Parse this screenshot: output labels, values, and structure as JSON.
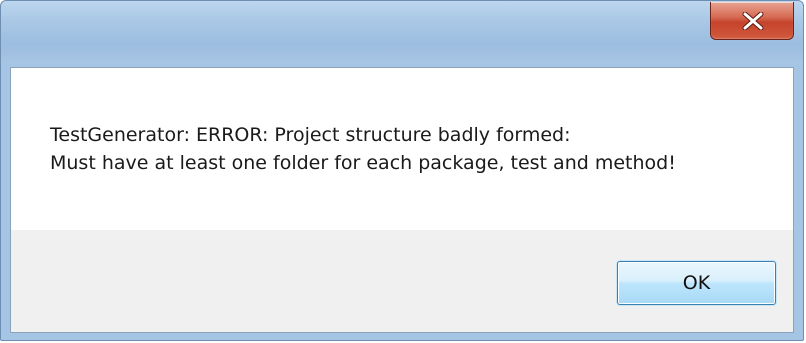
{
  "window": {
    "title": "",
    "close_icon": "close-icon"
  },
  "message": {
    "line1": "TestGenerator: ERROR: Project structure badly formed:",
    "line2": "Must have at least one folder for each package, test and method!"
  },
  "buttons": {
    "ok_label": "OK"
  },
  "colors": {
    "titlebar": "#a9c8e6",
    "close_button": "#c5432b",
    "ok_button_border": "#3c7fb1",
    "footer": "#f0f0f0"
  }
}
